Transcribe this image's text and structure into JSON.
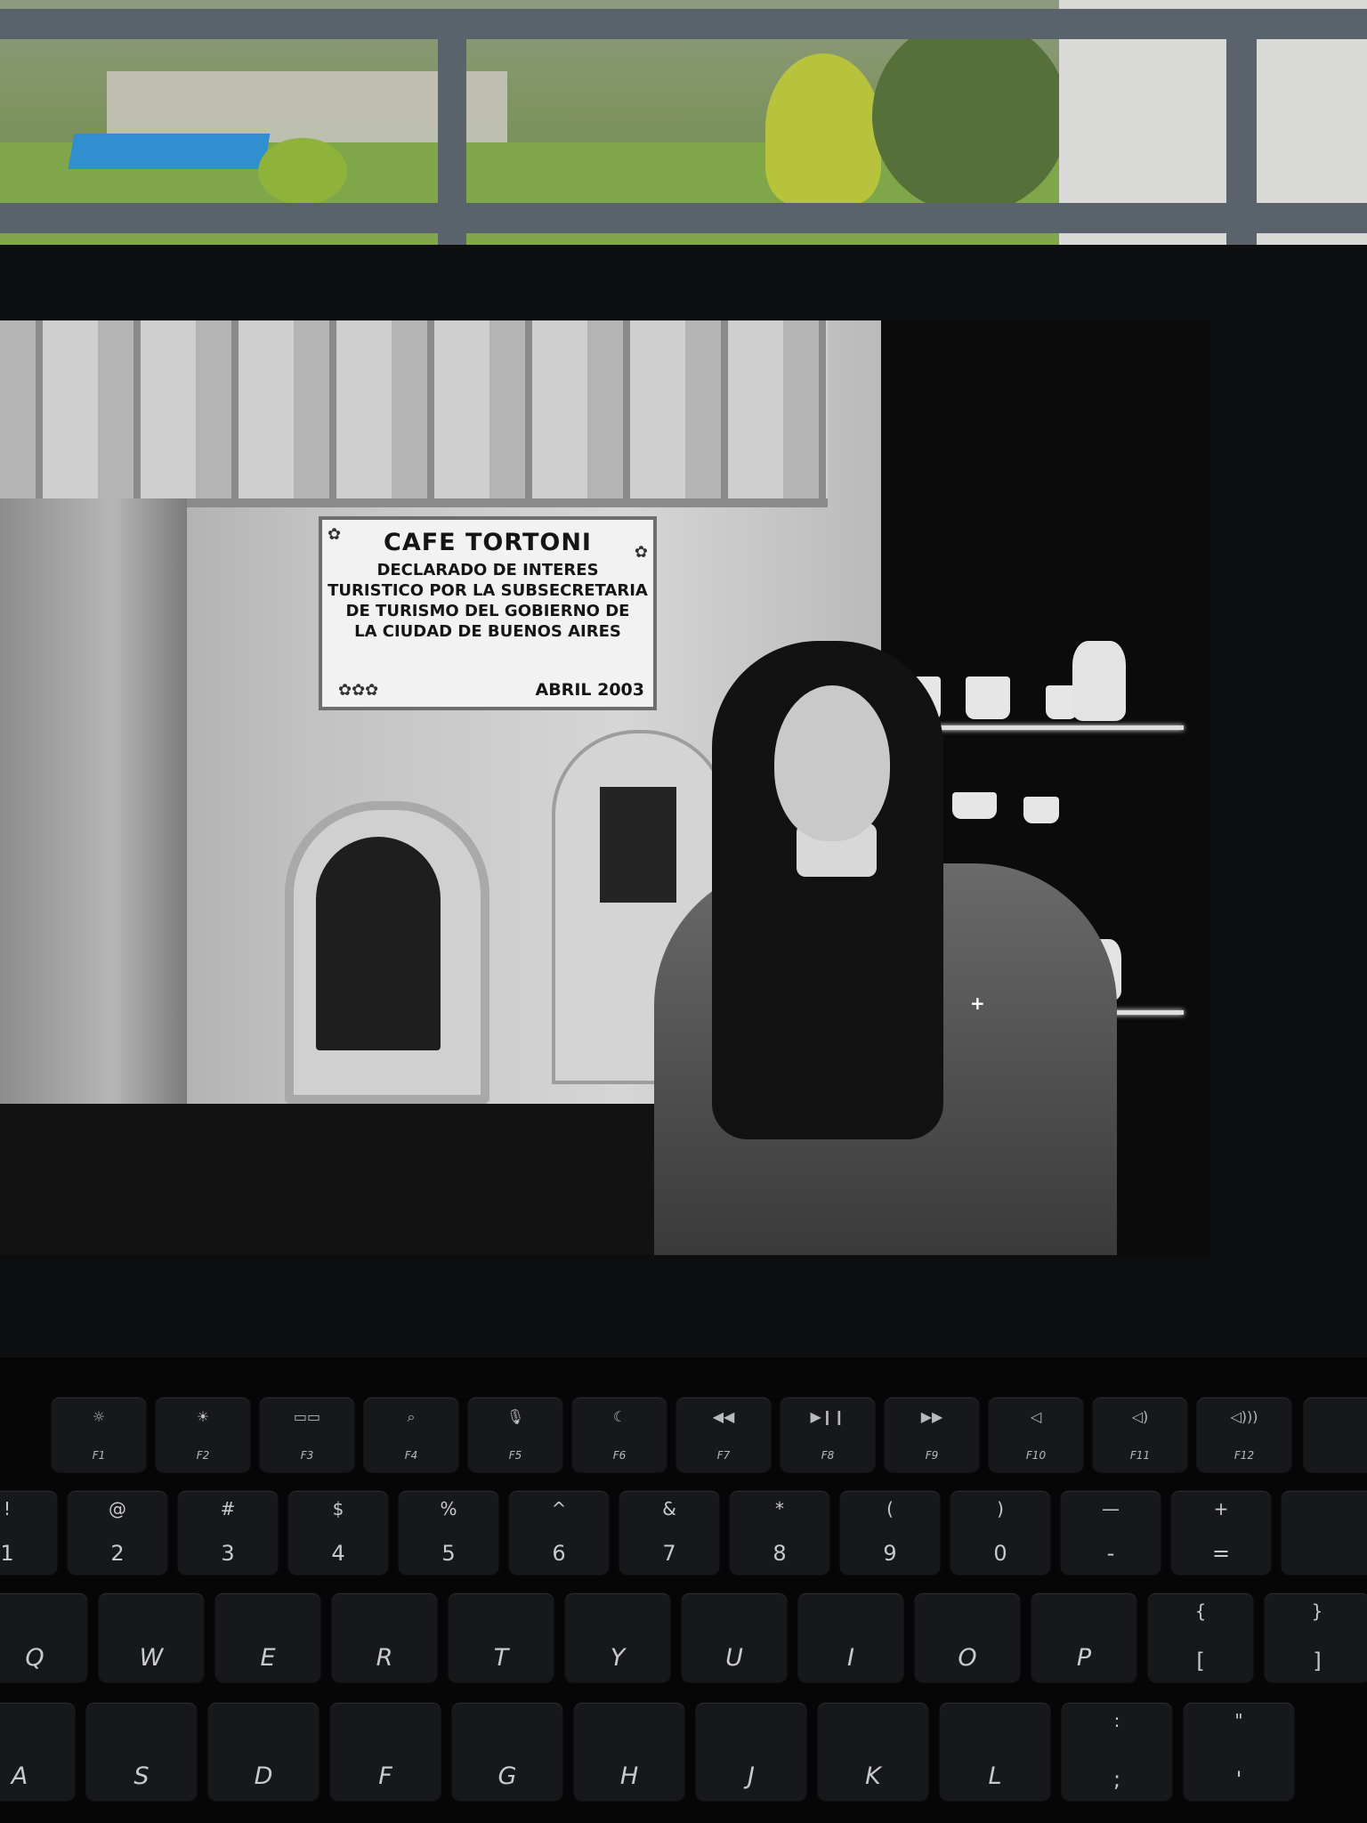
{
  "plaque": {
    "title": "CAFE TORTONI",
    "lines": [
      "DECLARADO DE INTERES",
      "TURISTICO POR LA SUBSECRETARIA",
      "DE TURISMO DEL GOBIERNO DE",
      "LA CIUDAD DE BUENOS AIRES"
    ],
    "date": "ABRIL 2003"
  },
  "function_keys": [
    {
      "icon": "☼",
      "label": "F1",
      "icon_name": "brightness-down-icon"
    },
    {
      "icon": "☀",
      "label": "F2",
      "icon_name": "brightness-up-icon"
    },
    {
      "icon": "▭▭",
      "label": "F3",
      "icon_name": "mission-control-icon"
    },
    {
      "icon": "⌕",
      "label": "F4",
      "icon_name": "search-icon"
    },
    {
      "icon": "🎙",
      "label": "F5",
      "icon_name": "microphone-icon"
    },
    {
      "icon": "☾",
      "label": "F6",
      "icon_name": "moon-icon"
    },
    {
      "icon": "◀◀",
      "label": "F7",
      "icon_name": "rewind-icon"
    },
    {
      "icon": "▶❙❙",
      "label": "F8",
      "icon_name": "play-pause-icon"
    },
    {
      "icon": "▶▶",
      "label": "F9",
      "icon_name": "fast-forward-icon"
    },
    {
      "icon": "◁",
      "label": "F10",
      "icon_name": "mute-icon"
    },
    {
      "icon": "◁)",
      "label": "F11",
      "icon_name": "volume-down-icon"
    },
    {
      "icon": "◁)))",
      "label": "F12",
      "icon_name": "volume-up-icon"
    }
  ],
  "number_row": [
    {
      "top": "!",
      "low": "1"
    },
    {
      "top": "@",
      "low": "2"
    },
    {
      "top": "#",
      "low": "3"
    },
    {
      "top": "$",
      "low": "4"
    },
    {
      "top": "%",
      "low": "5"
    },
    {
      "top": "^",
      "low": "6"
    },
    {
      "top": "&",
      "low": "7"
    },
    {
      "top": "*",
      "low": "8"
    },
    {
      "top": "(",
      "low": "9"
    },
    {
      "top": ")",
      "low": "0"
    },
    {
      "top": "—",
      "low": "-"
    },
    {
      "top": "+",
      "low": "="
    }
  ],
  "qwerty_row": [
    "Q",
    "W",
    "E",
    "R",
    "T",
    "Y",
    "U",
    "I",
    "O",
    "P"
  ],
  "qwerty_extra": [
    {
      "top": "{",
      "low": "["
    },
    {
      "top": "}",
      "low": "]"
    }
  ],
  "asdf_row": [
    "A",
    "S",
    "D",
    "F",
    "G",
    "H",
    "J",
    "K",
    "L"
  ],
  "asdf_extra": [
    {
      "top": ":",
      "low": ";"
    },
    {
      "top": "\"",
      "low": "'"
    }
  ]
}
